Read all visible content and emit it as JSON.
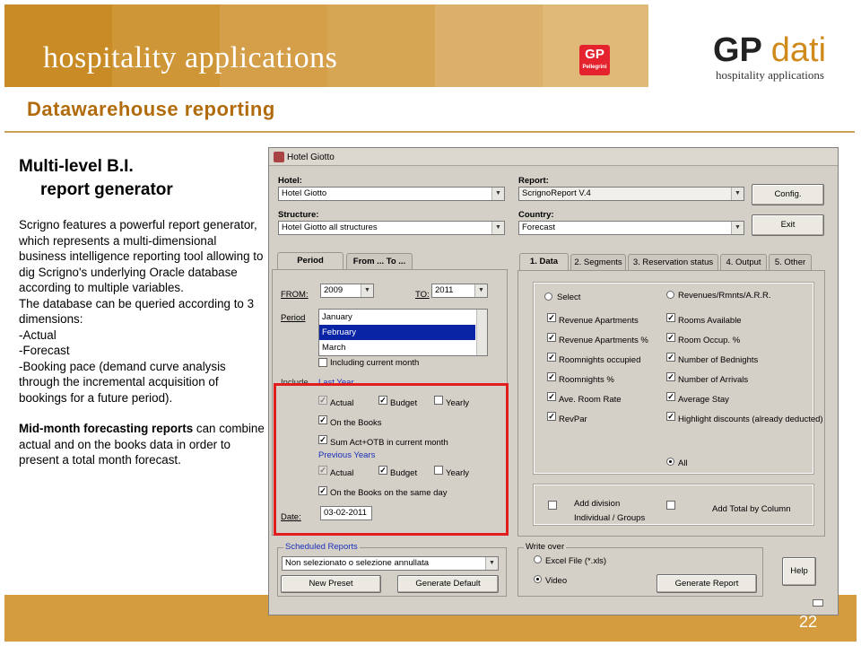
{
  "slide": {
    "brand": "hospitality applications",
    "logo_small": {
      "text": "GP",
      "sub": "Pellegrini"
    },
    "logo_big": {
      "gp": "GP",
      "dati": "dati",
      "tagline": "hospitality applications"
    },
    "title": "Datawarehouse reporting",
    "heading1": "Multi-level B.I.",
    "heading2": "report generator",
    "body": "Scrigno features a powerful report generator, which represents a multi-dimensional business intelligence reporting tool allowing to dig Scrigno's underlying Oracle database according to multiple variables.\nThe database can be queried according to 3 dimensions:\n-Actual\n-Forecast\n-Booking pace (demand curve analysis through the incremental acquisition of bookings for a future period).",
    "body2_bold": "Mid-month forecasting reports",
    "body2_rest": " can combine actual and on the books data in order to present a total month forecast.",
    "page_number": "22",
    "band_colors": [
      "#c98b25",
      "#cf9638",
      "#d49f48",
      "#d7a655",
      "#dbb068",
      "#e0b877"
    ]
  },
  "app": {
    "window_title": "Hotel Giotto",
    "hotel": {
      "label": "Hotel:",
      "value": "Hotel Giotto"
    },
    "structure": {
      "label": "Structure:",
      "value": "Hotel Giotto all structures"
    },
    "report": {
      "label": "Report:",
      "value": "ScrignoReport V.4"
    },
    "country": {
      "label": "Country:",
      "value": "Forecast"
    },
    "config_button": "Config.",
    "exit_button": "Exit",
    "left_tabs": [
      "Period",
      "From ... To ..."
    ],
    "from": {
      "label": "FROM:",
      "value": "2009"
    },
    "to": {
      "label": "TO:",
      "value": "2011"
    },
    "period": {
      "label": "Period",
      "items": [
        "January",
        "February",
        "March"
      ],
      "selected": "February",
      "including_current_month": "Including current month"
    },
    "include_label": "Include",
    "last_year_label": "Last Year",
    "actual": "Actual",
    "budget": "Budget",
    "yearly": "Yearly",
    "on_the_books": "On the Books",
    "sum_act_otb": "Sum Act+OTB in current month",
    "previous_years_label": "Previous Years",
    "actual2": "Actual",
    "budget2": "Budget",
    "yearly2": "Yearly",
    "on_the_books_same_day": "On the Books on the same day",
    "date": {
      "label": "Date:",
      "value": "03-02-2011"
    },
    "right_tabs": [
      "1. Data",
      "2. Segments",
      "3. Reservation status",
      "4. Output",
      "5. Other"
    ],
    "select_radio": "Select",
    "revenues_radio": "Revenues/Rmnts/A.R.R.",
    "data_left": [
      "Revenue Apartments",
      "Revenue Apartments %",
      "Roomnights occupied",
      "Roomnights %",
      "Ave. Room Rate",
      "RevPar"
    ],
    "data_right": [
      "Rooms Available",
      "Room Occup. %",
      "Number of Bednights",
      "Number of Arrivals",
      "Average Stay",
      "Highlight discounts (already deducted)"
    ],
    "all_radio": "All",
    "add_division_1": "Add division",
    "add_division_2": "Individual / Groups",
    "add_total_by_column": "Add Total by Column",
    "scheduled_reports": {
      "label": "Scheduled Reports",
      "value": "Non selezionato o selezione annullata",
      "new_preset": "New Preset",
      "generate_default": "Generate Default"
    },
    "write_over": {
      "label": "Write over",
      "excel": "Excel File (*.xls)",
      "video": "Video",
      "generate_report": "Generate Report"
    },
    "help_button": "Help"
  }
}
